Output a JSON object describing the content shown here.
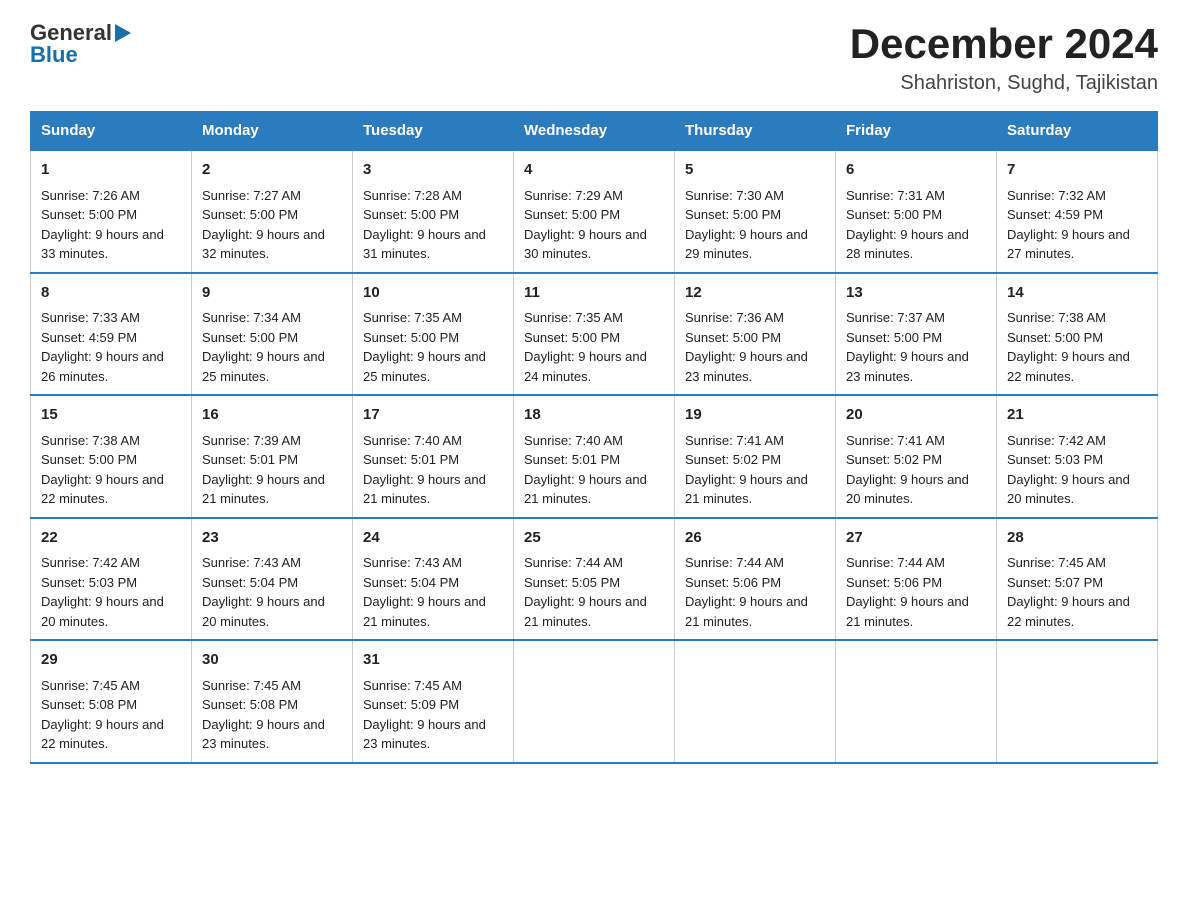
{
  "header": {
    "logo_general": "General",
    "logo_blue": "Blue",
    "month_year": "December 2024",
    "location": "Shahriston, Sughd, Tajikistan"
  },
  "columns": [
    "Sunday",
    "Monday",
    "Tuesday",
    "Wednesday",
    "Thursday",
    "Friday",
    "Saturday"
  ],
  "weeks": [
    [
      {
        "day": "1",
        "sunrise": "Sunrise: 7:26 AM",
        "sunset": "Sunset: 5:00 PM",
        "daylight": "Daylight: 9 hours and 33 minutes."
      },
      {
        "day": "2",
        "sunrise": "Sunrise: 7:27 AM",
        "sunset": "Sunset: 5:00 PM",
        "daylight": "Daylight: 9 hours and 32 minutes."
      },
      {
        "day": "3",
        "sunrise": "Sunrise: 7:28 AM",
        "sunset": "Sunset: 5:00 PM",
        "daylight": "Daylight: 9 hours and 31 minutes."
      },
      {
        "day": "4",
        "sunrise": "Sunrise: 7:29 AM",
        "sunset": "Sunset: 5:00 PM",
        "daylight": "Daylight: 9 hours and 30 minutes."
      },
      {
        "day": "5",
        "sunrise": "Sunrise: 7:30 AM",
        "sunset": "Sunset: 5:00 PM",
        "daylight": "Daylight: 9 hours and 29 minutes."
      },
      {
        "day": "6",
        "sunrise": "Sunrise: 7:31 AM",
        "sunset": "Sunset: 5:00 PM",
        "daylight": "Daylight: 9 hours and 28 minutes."
      },
      {
        "day": "7",
        "sunrise": "Sunrise: 7:32 AM",
        "sunset": "Sunset: 4:59 PM",
        "daylight": "Daylight: 9 hours and 27 minutes."
      }
    ],
    [
      {
        "day": "8",
        "sunrise": "Sunrise: 7:33 AM",
        "sunset": "Sunset: 4:59 PM",
        "daylight": "Daylight: 9 hours and 26 minutes."
      },
      {
        "day": "9",
        "sunrise": "Sunrise: 7:34 AM",
        "sunset": "Sunset: 5:00 PM",
        "daylight": "Daylight: 9 hours and 25 minutes."
      },
      {
        "day": "10",
        "sunrise": "Sunrise: 7:35 AM",
        "sunset": "Sunset: 5:00 PM",
        "daylight": "Daylight: 9 hours and 25 minutes."
      },
      {
        "day": "11",
        "sunrise": "Sunrise: 7:35 AM",
        "sunset": "Sunset: 5:00 PM",
        "daylight": "Daylight: 9 hours and 24 minutes."
      },
      {
        "day": "12",
        "sunrise": "Sunrise: 7:36 AM",
        "sunset": "Sunset: 5:00 PM",
        "daylight": "Daylight: 9 hours and 23 minutes."
      },
      {
        "day": "13",
        "sunrise": "Sunrise: 7:37 AM",
        "sunset": "Sunset: 5:00 PM",
        "daylight": "Daylight: 9 hours and 23 minutes."
      },
      {
        "day": "14",
        "sunrise": "Sunrise: 7:38 AM",
        "sunset": "Sunset: 5:00 PM",
        "daylight": "Daylight: 9 hours and 22 minutes."
      }
    ],
    [
      {
        "day": "15",
        "sunrise": "Sunrise: 7:38 AM",
        "sunset": "Sunset: 5:00 PM",
        "daylight": "Daylight: 9 hours and 22 minutes."
      },
      {
        "day": "16",
        "sunrise": "Sunrise: 7:39 AM",
        "sunset": "Sunset: 5:01 PM",
        "daylight": "Daylight: 9 hours and 21 minutes."
      },
      {
        "day": "17",
        "sunrise": "Sunrise: 7:40 AM",
        "sunset": "Sunset: 5:01 PM",
        "daylight": "Daylight: 9 hours and 21 minutes."
      },
      {
        "day": "18",
        "sunrise": "Sunrise: 7:40 AM",
        "sunset": "Sunset: 5:01 PM",
        "daylight": "Daylight: 9 hours and 21 minutes."
      },
      {
        "day": "19",
        "sunrise": "Sunrise: 7:41 AM",
        "sunset": "Sunset: 5:02 PM",
        "daylight": "Daylight: 9 hours and 21 minutes."
      },
      {
        "day": "20",
        "sunrise": "Sunrise: 7:41 AM",
        "sunset": "Sunset: 5:02 PM",
        "daylight": "Daylight: 9 hours and 20 minutes."
      },
      {
        "day": "21",
        "sunrise": "Sunrise: 7:42 AM",
        "sunset": "Sunset: 5:03 PM",
        "daylight": "Daylight: 9 hours and 20 minutes."
      }
    ],
    [
      {
        "day": "22",
        "sunrise": "Sunrise: 7:42 AM",
        "sunset": "Sunset: 5:03 PM",
        "daylight": "Daylight: 9 hours and 20 minutes."
      },
      {
        "day": "23",
        "sunrise": "Sunrise: 7:43 AM",
        "sunset": "Sunset: 5:04 PM",
        "daylight": "Daylight: 9 hours and 20 minutes."
      },
      {
        "day": "24",
        "sunrise": "Sunrise: 7:43 AM",
        "sunset": "Sunset: 5:04 PM",
        "daylight": "Daylight: 9 hours and 21 minutes."
      },
      {
        "day": "25",
        "sunrise": "Sunrise: 7:44 AM",
        "sunset": "Sunset: 5:05 PM",
        "daylight": "Daylight: 9 hours and 21 minutes."
      },
      {
        "day": "26",
        "sunrise": "Sunrise: 7:44 AM",
        "sunset": "Sunset: 5:06 PM",
        "daylight": "Daylight: 9 hours and 21 minutes."
      },
      {
        "day": "27",
        "sunrise": "Sunrise: 7:44 AM",
        "sunset": "Sunset: 5:06 PM",
        "daylight": "Daylight: 9 hours and 21 minutes."
      },
      {
        "day": "28",
        "sunrise": "Sunrise: 7:45 AM",
        "sunset": "Sunset: 5:07 PM",
        "daylight": "Daylight: 9 hours and 22 minutes."
      }
    ],
    [
      {
        "day": "29",
        "sunrise": "Sunrise: 7:45 AM",
        "sunset": "Sunset: 5:08 PM",
        "daylight": "Daylight: 9 hours and 22 minutes."
      },
      {
        "day": "30",
        "sunrise": "Sunrise: 7:45 AM",
        "sunset": "Sunset: 5:08 PM",
        "daylight": "Daylight: 9 hours and 23 minutes."
      },
      {
        "day": "31",
        "sunrise": "Sunrise: 7:45 AM",
        "sunset": "Sunset: 5:09 PM",
        "daylight": "Daylight: 9 hours and 23 minutes."
      },
      null,
      null,
      null,
      null
    ]
  ]
}
